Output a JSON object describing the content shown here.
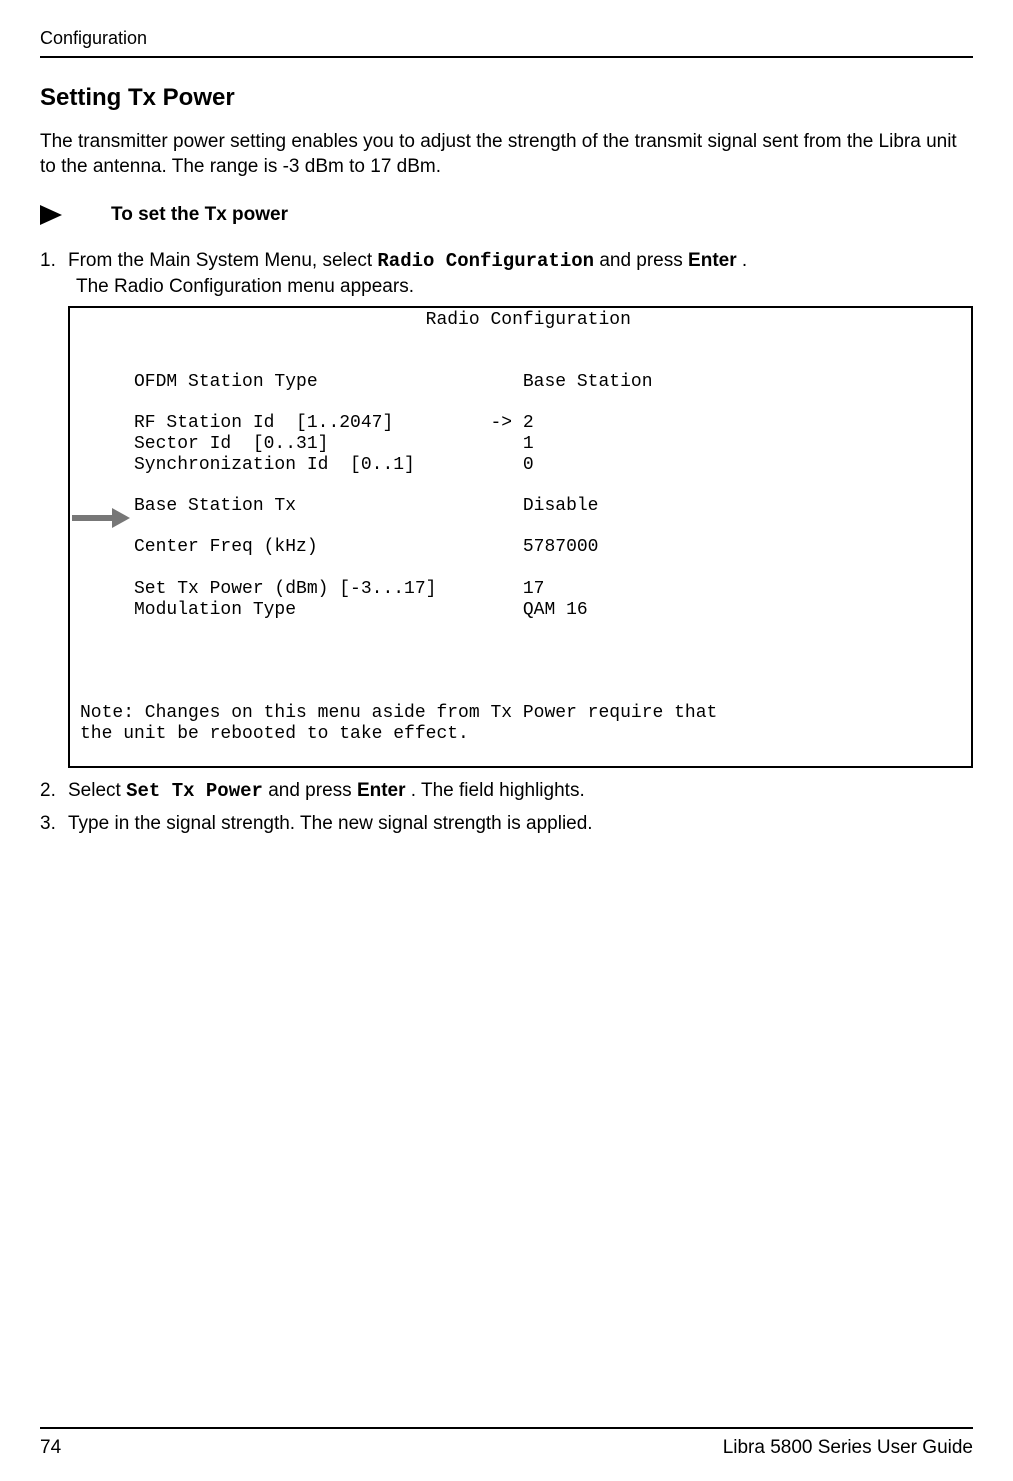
{
  "header": {
    "running_head": "Configuration"
  },
  "section": {
    "title": "Setting Tx Power"
  },
  "intro": {
    "para": "The transmitter power setting enables you to adjust the strength of the transmit signal sent from the Libra unit to the antenna. The range is -3 dBm to 17 dBm."
  },
  "procedure": {
    "label": "To set the Tx power"
  },
  "steps": {
    "step1_pre": "From the Main System Menu, select ",
    "step1_cmd": "Radio Configuration",
    "step1_mid": " and press ",
    "step1_key": "Enter",
    "step1_post": ".",
    "step1_result": "The Radio Configuration menu appears.",
    "step2_pre": "Select ",
    "step2_cmd": "Set Tx Power",
    "step2_mid": " and press ",
    "step2_key": "Enter",
    "step2_post": ". The field highlights.",
    "step3": "Type in the signal strength. The new signal strength is applied."
  },
  "terminal": {
    "title": "                                Radio Configuration",
    "line_ofdm": "     OFDM Station Type                   Base Station",
    "line_rf": "     RF Station Id  [1..2047]         -> 2",
    "line_sec": "     Sector Id  [0..31]                  1",
    "line_sync": "     Synchronization Id  [0..1]          0",
    "line_bst": "     Base Station Tx                     Disable",
    "line_freq": "     Center Freq (kHz)                   5787000",
    "line_pow": "     Set Tx Power (dBm) [-3...17]        17",
    "line_mod": "     Modulation Type                     QAM 16",
    "note1": "Note: Changes on this menu aside from Tx Power require that",
    "note2": "the unit be rebooted to take effect."
  },
  "footer": {
    "page": "74",
    "doc": "Libra 5800 Series User Guide"
  }
}
